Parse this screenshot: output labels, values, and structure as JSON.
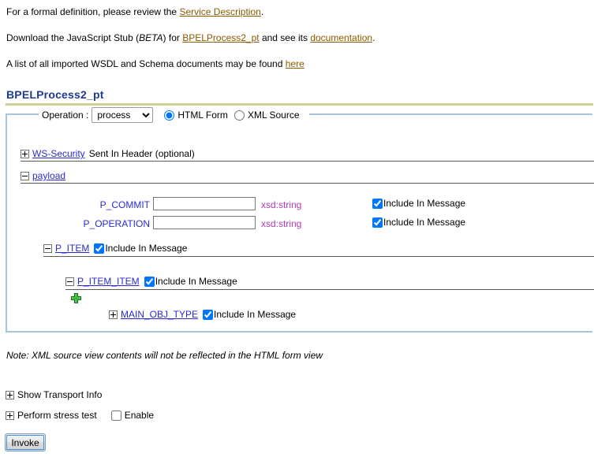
{
  "intro": {
    "line1_pre": "For a formal definition, please review the ",
    "line1_link": "Service Description",
    "line1_post": ".",
    "line2_pre": "Download the JavaScript Stub (",
    "line2_beta": "BETA",
    "line2_mid": ") for ",
    "line2_link1": "BPELProcess2_pt",
    "line2_mid2": " and see its ",
    "line2_link2": "documentation",
    "line2_post": ".",
    "line3_pre": "A list of all imported WSDL and Schema documents may be found ",
    "line3_link": "here"
  },
  "service": {
    "title": "BPELProcess2_pt"
  },
  "operation": {
    "label": "Operation :",
    "selected": "process",
    "options": [
      "process"
    ],
    "view_html_label": "HTML Form",
    "view_xml_label": "XML Source",
    "view_selected": "HTML Form"
  },
  "tree": {
    "ws_security": {
      "link": "WS-Security",
      "suffix": "Sent In Header (optional)",
      "state": "collapsed"
    },
    "payload": {
      "link": "payload",
      "state": "expanded"
    },
    "p_item": {
      "link": "P_ITEM",
      "state": "expanded",
      "include_label": "Include In Message",
      "include_checked": true
    },
    "p_item_item": {
      "link": "P_ITEM_ITEM",
      "state": "expanded",
      "include_label": "Include In Message",
      "include_checked": true
    },
    "main_obj_type": {
      "link": "MAIN_OBJ_TYPE",
      "state": "collapsed",
      "include_label": "Include In Message",
      "include_checked": true
    },
    "add_icon": "plus-green-icon"
  },
  "fields": [
    {
      "label": "P_COMMIT",
      "value": "",
      "type": "xsd:string",
      "include_label": "Include In Message",
      "include_checked": true
    },
    {
      "label": "P_OPERATION",
      "value": "",
      "type": "xsd:string",
      "include_label": "Include In Message",
      "include_checked": true
    }
  ],
  "note": "Note: XML source view contents will not be reflected in the HTML form view",
  "bottom": {
    "transport_label": "Show Transport Info",
    "transport_state": "collapsed",
    "stress_label": "Perform stress test",
    "stress_state": "collapsed",
    "enable_label": "Enable",
    "enable_checked": false,
    "invoke_label": "Invoke"
  },
  "colors": {
    "link_brown": "#8a5a00",
    "node_blue": "#2a2ad0",
    "title_navy": "#1f3a93",
    "type_magenta": "#b03cb0",
    "rule_olive": "#cfcf94",
    "fieldset_blue": "#a8c4d8",
    "plus_green": "#2ea82e"
  }
}
